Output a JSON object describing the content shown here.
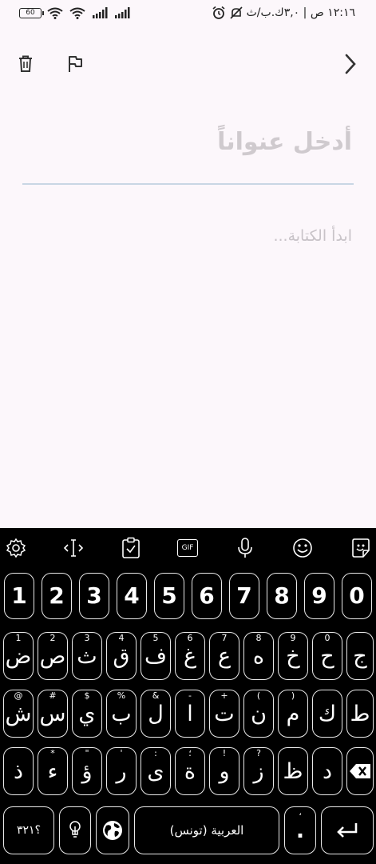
{
  "status": {
    "battery": "60",
    "time": "١٢:١٦ ص | ٣,٠ك.ب/ث"
  },
  "app_bar": {
    "icons": [
      "delete-icon",
      "flag-icon",
      "chevron-right-icon"
    ]
  },
  "editor": {
    "title_placeholder": "أدخل عنواناً",
    "body_placeholder": "ابدأ الكتابة..."
  },
  "keyboard": {
    "toolbar": [
      "settings-icon",
      "cursor-icon",
      "clipboard-icon",
      "gif-icon",
      "mic-icon",
      "emoji-icon",
      "sticker-icon"
    ],
    "gif_label": "GIF",
    "numbers": [
      "1",
      "2",
      "3",
      "4",
      "5",
      "6",
      "7",
      "8",
      "9",
      "0"
    ],
    "row1": [
      {
        "main": "ض",
        "sub": "1"
      },
      {
        "main": "ص",
        "sub": "2"
      },
      {
        "main": "ث",
        "sub": "3"
      },
      {
        "main": "ق",
        "sub": "4"
      },
      {
        "main": "ف",
        "sub": "5"
      },
      {
        "main": "غ",
        "sub": "6"
      },
      {
        "main": "ع",
        "sub": "7"
      },
      {
        "main": "ه",
        "sub": "8"
      },
      {
        "main": "خ",
        "sub": "9"
      },
      {
        "main": "ح",
        "sub": "0"
      },
      {
        "main": "ج",
        "sub": ""
      }
    ],
    "row2": [
      {
        "main": "ش",
        "sub": "@"
      },
      {
        "main": "س",
        "sub": "#"
      },
      {
        "main": "ي",
        "sub": "$"
      },
      {
        "main": "ب",
        "sub": "%"
      },
      {
        "main": "ل",
        "sub": "&"
      },
      {
        "main": "ا",
        "sub": "-"
      },
      {
        "main": "ت",
        "sub": "+"
      },
      {
        "main": "ن",
        "sub": "("
      },
      {
        "main": "م",
        "sub": ")"
      },
      {
        "main": "ك",
        "sub": ""
      },
      {
        "main": "ط",
        "sub": ""
      }
    ],
    "row3": [
      {
        "main": "ذ",
        "sub": ""
      },
      {
        "main": "ء",
        "sub": "*"
      },
      {
        "main": "ؤ",
        "sub": "\""
      },
      {
        "main": "ر",
        "sub": "'"
      },
      {
        "main": "ى",
        "sub": ":"
      },
      {
        "main": "ة",
        "sub": "؛"
      },
      {
        "main": "و",
        "sub": "!"
      },
      {
        "main": "ز",
        "sub": "?"
      },
      {
        "main": "ظ",
        "sub": ""
      },
      {
        "main": "د",
        "sub": ""
      }
    ],
    "symbols_label": "؟٣٢١",
    "space_label": "العربية (تونس)",
    "period_label": ".",
    "comma_label": "،"
  }
}
